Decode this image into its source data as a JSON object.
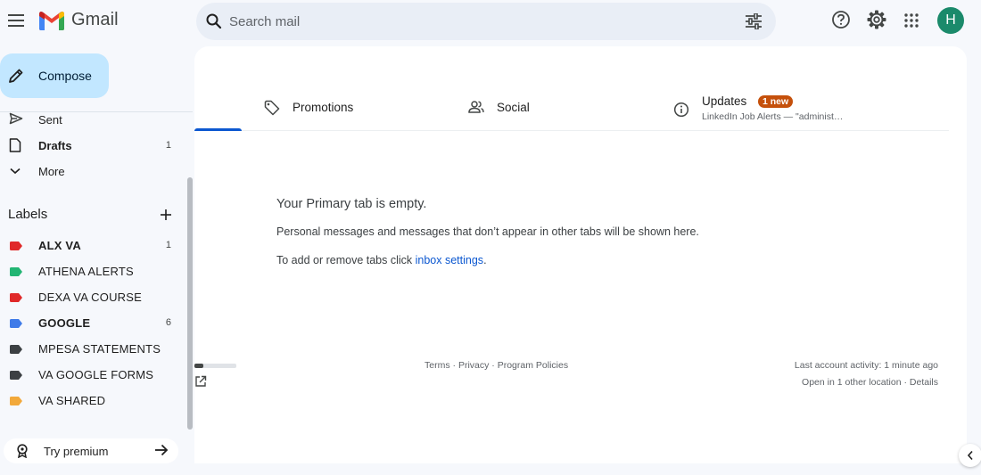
{
  "app": {
    "name": "Gmail",
    "avatar_letter": "H",
    "colors": {
      "accent": "#0b57d0",
      "compose_bg": "#c2e7ff",
      "avatar_bg": "#1b8a6b",
      "badge_bg": "#c5500b"
    }
  },
  "search": {
    "placeholder": "Search mail",
    "value": ""
  },
  "header_icons": [
    "menu-icon",
    "search-icon",
    "filter-icon",
    "help-icon",
    "settings-icon",
    "apps-icon"
  ],
  "sidebar": {
    "compose_label": "Compose",
    "nav_items": [
      {
        "label": "Sent",
        "icon": "send-icon",
        "count": "",
        "bold": false
      },
      {
        "label": "Drafts",
        "icon": "draft-icon",
        "count": "1",
        "bold": true
      },
      {
        "label": "More",
        "icon": "chevron-down-icon",
        "count": "",
        "bold": false
      }
    ],
    "labels_header": "Labels",
    "labels": [
      {
        "name": "ALX VA",
        "color": "#e02929",
        "count": "1",
        "bold": true
      },
      {
        "name": "ATHENA ALERTS",
        "color": "#22b573",
        "count": "",
        "bold": false
      },
      {
        "name": "DEXA VA COURSE",
        "color": "#e02929",
        "count": "",
        "bold": false
      },
      {
        "name": "GOOGLE",
        "color": "#3f7be8",
        "count": "6",
        "bold": true
      },
      {
        "name": "MPESA STATEMENTS",
        "color": "#3c4043",
        "count": "",
        "bold": false
      },
      {
        "name": "VA GOOGLE FORMS",
        "color": "#3c4043",
        "count": "",
        "bold": false
      },
      {
        "name": "VA SHARED",
        "color": "#f2a93b",
        "count": "",
        "bold": false
      }
    ],
    "premium_label": "Try premium"
  },
  "tabs": {
    "promotions": "Promotions",
    "social": "Social",
    "updates": "Updates",
    "updates_badge": "1 new",
    "updates_snippet": "LinkedIn Job Alerts — \"administ…"
  },
  "empty_state": {
    "title": "Your Primary tab is empty.",
    "description": "Personal messages and messages that don’t appear in other tabs will be shown here.",
    "link_prefix": "To add or remove tabs click ",
    "link_text": "inbox settings",
    "link_suffix": "."
  },
  "footer": {
    "terms": "Terms",
    "privacy": "Privacy",
    "program_policies": "Program Policies",
    "separator": " · ",
    "activity": "Last account activity: 1 minute ago",
    "other_location": "Open in 1 other location",
    "details": "Details",
    "storage_fraction": 0.22
  }
}
